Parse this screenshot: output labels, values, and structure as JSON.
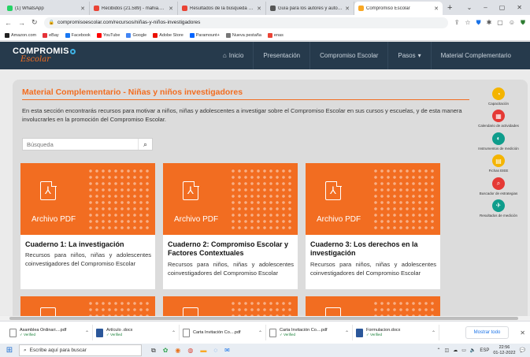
{
  "browser": {
    "tabs": [
      {
        "label": "(1) WhatsApp",
        "color": "#25d366",
        "active": false
      },
      {
        "label": "Recibidos (21.589) - mahia.sa.c",
        "color": "#ea4335",
        "active": false
      },
      {
        "label": "Resultados de la búsqueda - m",
        "color": "#ea4335",
        "active": false
      },
      {
        "label": "Guía para los autores y autoras",
        "color": "#555555",
        "active": false
      },
      {
        "label": "Compromiso Escolar",
        "color": "#f9a825",
        "active": true
      }
    ],
    "new_tab": "+",
    "window_controls": [
      "⌄",
      "–",
      "▢",
      "✕"
    ],
    "url": "compromisoescolar.com/recursos/niñas-y-niños-investigadores",
    "bookmarks": [
      {
        "label": "Amazon.com",
        "color": "#222222"
      },
      {
        "label": "eBay",
        "color": "#e53238"
      },
      {
        "label": "Facebook",
        "color": "#1877f2"
      },
      {
        "label": "YouTube",
        "color": "#ff0000"
      },
      {
        "label": "Google",
        "color": "#4285f4"
      },
      {
        "label": "Adobe Store",
        "color": "#eb1000"
      },
      {
        "label": "Paramount+",
        "color": "#0064ff"
      },
      {
        "label": "Nueva pestaña",
        "color": "#777777"
      },
      {
        "label": "enas",
        "color": "#ea4335"
      }
    ]
  },
  "site": {
    "logo_top": "COMPROMIS",
    "logo_bottom": "Escolar",
    "nav": [
      {
        "label": "Inicio",
        "icon": "home-icon"
      },
      {
        "label": "Presentación"
      },
      {
        "label": "Compromiso Escolar"
      },
      {
        "label": "Pasos",
        "caret": "▾"
      },
      {
        "label": "Material Complementario"
      }
    ]
  },
  "page": {
    "title": "Material Complementario - Niñas y niños investigadores",
    "intro": "En esta sección encontrarás recursos para motivar a niños, niñas y adolescentes a investigar sobre el Compromiso Escolar en sus cursos y escuelas, y de esta manera involucrarles en la promoción del Compromiso Escolar.",
    "search_placeholder": "Búsqueda",
    "cards": [
      {
        "file_type": "Archivo PDF",
        "title": "Cuaderno 1: La investigación",
        "description": "Recursos para niños, niñas y adolescentes coinvestigadores del Compromiso Escolar"
      },
      {
        "file_type": "Archivo PDF",
        "title": "Cuaderno 2: Compromiso Escolar y Factores Contextuales",
        "description": "Recursos para niños, niñas y adolescentes coinvestigadores del Compromiso Escolar"
      },
      {
        "file_type": "Archivo PDF",
        "title": "Cuaderno 3: Los derechos en la investigación",
        "description": "Recursos para niños, niñas y adolescentes coinvestigadores del Compromiso Escolar"
      }
    ]
  },
  "quick_access": [
    {
      "label": "Capacitación",
      "color": "#f4b400",
      "glyph": "◔"
    },
    {
      "label": "Calendario de actividades",
      "color": "#e53935",
      "glyph": "▦"
    },
    {
      "label": "Instrumentos de medición",
      "color": "#0f9d8c",
      "glyph": "◐"
    },
    {
      "label": "Fichas EIEE",
      "color": "#f4b400",
      "glyph": "▤"
    },
    {
      "label": "Buscador de estrategias",
      "color": "#e53935",
      "glyph": "⌕"
    },
    {
      "label": "Resultados de medición",
      "color": "#0f9d8c",
      "glyph": "✈"
    }
  ],
  "downloads": {
    "items": [
      {
        "name": "Asamblea Ordinari....pdf",
        "status": "✓ Verified",
        "kind": "pdf"
      },
      {
        "name": "Artículo .docx",
        "status": "✓ Verified",
        "kind": "word"
      },
      {
        "name": "Carta Invitación Co....pdf",
        "status": "",
        "kind": "pdf"
      },
      {
        "name": "Carta Invitación Co....pdf",
        "status": "✓ Verified",
        "kind": "pdf"
      },
      {
        "name": "Formulacion.docx",
        "status": "✓ Verified",
        "kind": "word"
      }
    ],
    "show_all": "Mostrar todo"
  },
  "taskbar": {
    "search_placeholder": "Escribe aquí para buscar",
    "language": "ESP",
    "time": "22:56",
    "date": "01-12-2022"
  }
}
